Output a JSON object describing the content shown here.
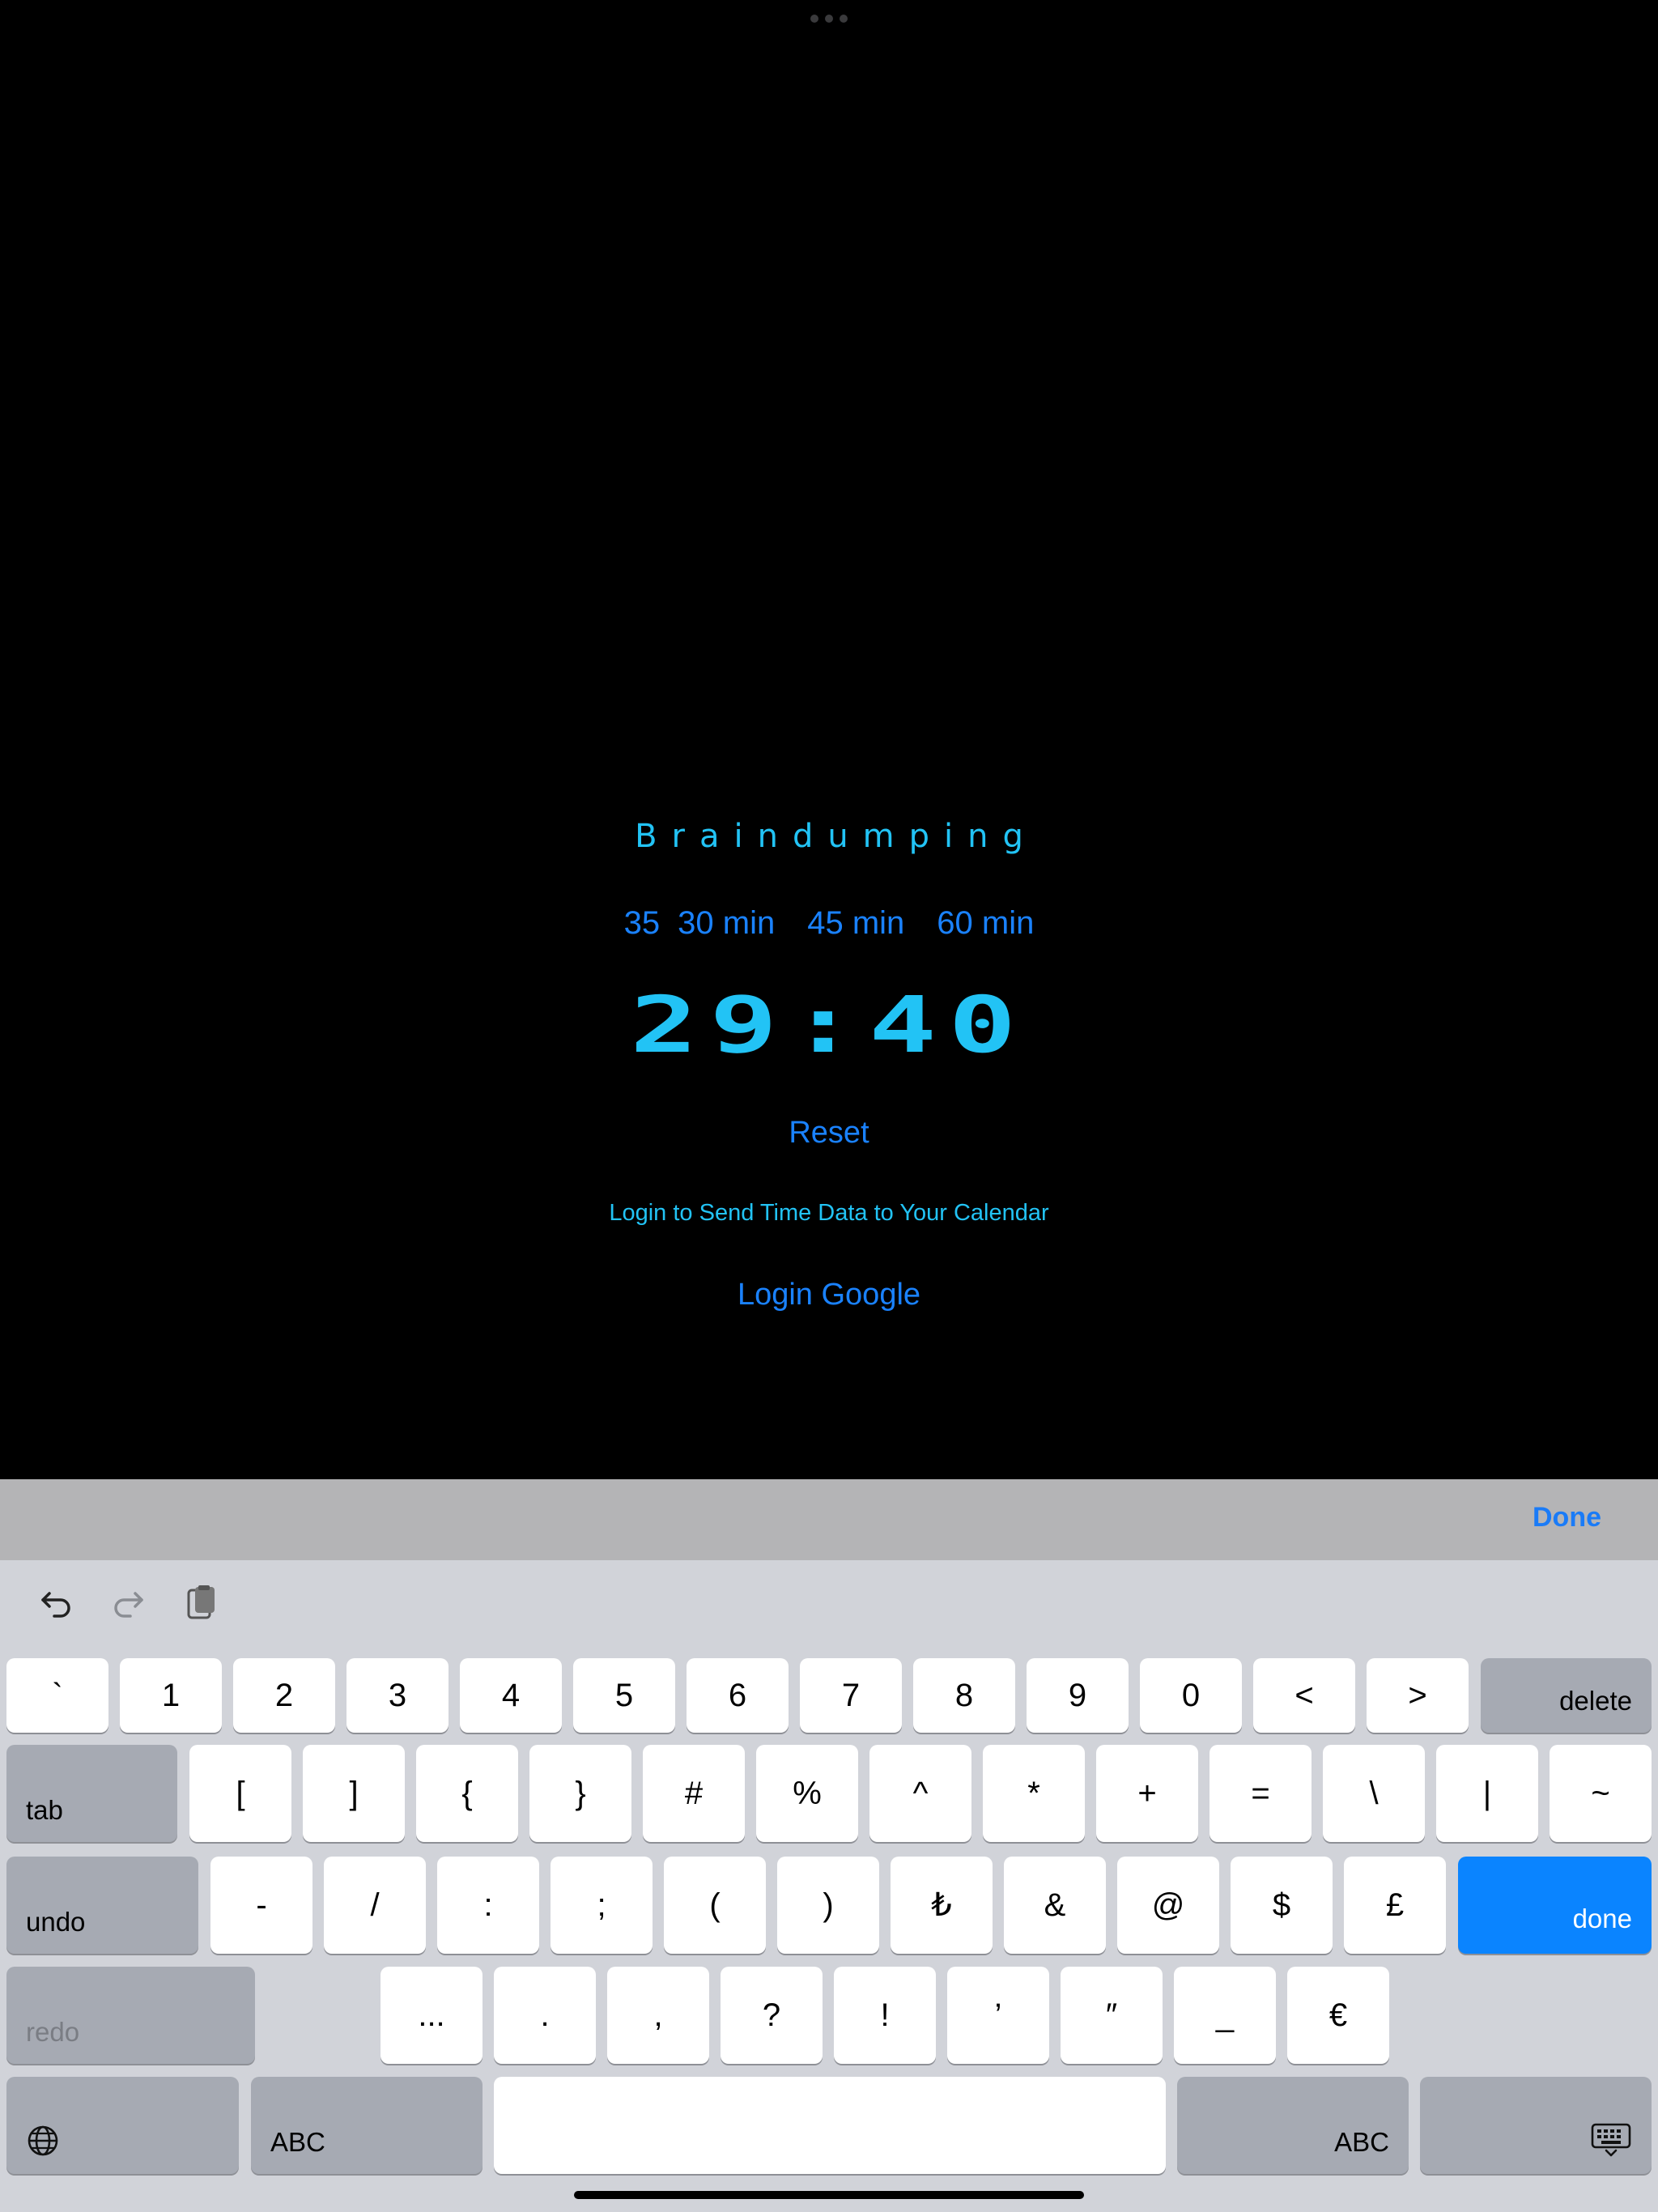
{
  "colors": {
    "background": "#000000",
    "accent_cyan": "#22c3f5",
    "link_blue": "#1a82ff",
    "keyboard_bg": "#d1d3d9",
    "key_modifier": "#a6aab3",
    "done_key": "#0a84ff"
  },
  "timer": {
    "mode_title": "Braindumping",
    "durations": [
      "35",
      "30 min",
      "45 min",
      "60 min"
    ],
    "clock": "29:40",
    "reset_label": "Reset",
    "login_hint": "Login to Send Time Data to Your Calendar",
    "login_google_label": "Login Google"
  },
  "accessory_bar": {
    "done_label": "Done"
  },
  "keyboard": {
    "shortcuts": [
      "undo-icon",
      "redo-icon",
      "paste-icon"
    ],
    "row1": [
      "`",
      "1",
      "2",
      "3",
      "4",
      "5",
      "6",
      "7",
      "8",
      "9",
      "0",
      "<",
      ">"
    ],
    "row1_mod": "delete",
    "row2_mod": "tab",
    "row2": [
      "[",
      "]",
      "{",
      "}",
      "#",
      "%",
      "^",
      "*",
      "+",
      "=",
      "\\",
      "|",
      "~"
    ],
    "row3_mod": "undo",
    "row3": [
      "-",
      "/",
      ":",
      ";",
      "(",
      ")",
      "₺",
      "&",
      "@",
      "$",
      "£"
    ],
    "row3_done": "done",
    "row4_mod": "redo",
    "row4": [
      "...",
      ".",
      ",",
      "?",
      "!",
      "’",
      "″",
      "_",
      "€"
    ],
    "row5_left_abc": "ABC",
    "row5_right_abc": "ABC",
    "globe_icon": "globe-icon",
    "dismiss_icon": "keyboard-dismiss-icon"
  }
}
